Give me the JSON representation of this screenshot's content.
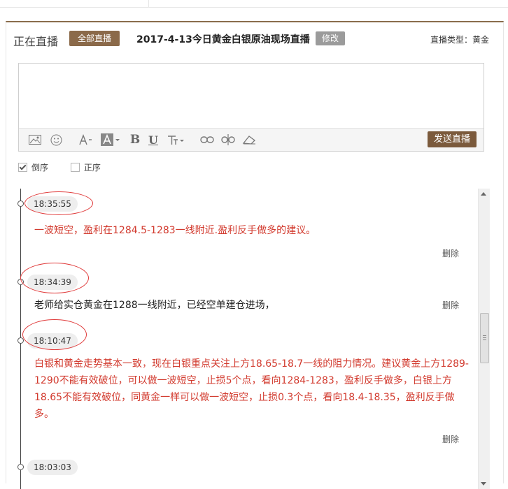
{
  "header": {
    "live_label": "正在直播",
    "all_live_button": "全部直播",
    "title": "2017-4-13今日黄金白银原油现场直播",
    "edit_button": "修改",
    "live_type": "直播类型：黄金"
  },
  "editor": {
    "value": "",
    "send_button": "发送直播",
    "toolbar_icons": [
      "image-icon",
      "emoji-icon",
      "font-size-icon",
      "font-color-icon",
      "bold-icon",
      "underline-icon",
      "text-style-icon",
      "link-icon",
      "unlink-icon",
      "eraser-icon"
    ],
    "bold_glyph": "B",
    "underline_glyph": "U"
  },
  "order": {
    "desc_label": "倒序",
    "asc_label": "正序",
    "desc_checked": true,
    "asc_checked": false
  },
  "feed": {
    "delete_label": "删除",
    "entries": [
      {
        "time": "18:35:55",
        "text": "一波短空，盈利在1284.5-1283一线附近.盈利反手做多的建议。",
        "color": "#d23a2e"
      },
      {
        "time": "18:34:39",
        "text": "老师给实仓黄金在1288一线附近，已经空单建仓进场，",
        "color": "#222222"
      },
      {
        "time": "18:10:47",
        "text": "白银和黄金走势基本一致，现在白银重点关注上方18.65-18.7一线的阻力情况。建议黄金上方1289-1290不能有效破位，可以做一波短空，止损5个点，看向1284-1283，盈利反手做多，白银上方18.65不能有效破位，同黄金一样可以做一波短空，止损0.3个点，看向18.4-18.35，盈利反手做多。",
        "color": "#d23a2e"
      },
      {
        "time": "18:03:03",
        "text": "",
        "color": "#222222"
      }
    ]
  },
  "colors": {
    "accent_brown": "#8b6a4a",
    "highlight_red": "#e03a3a"
  }
}
